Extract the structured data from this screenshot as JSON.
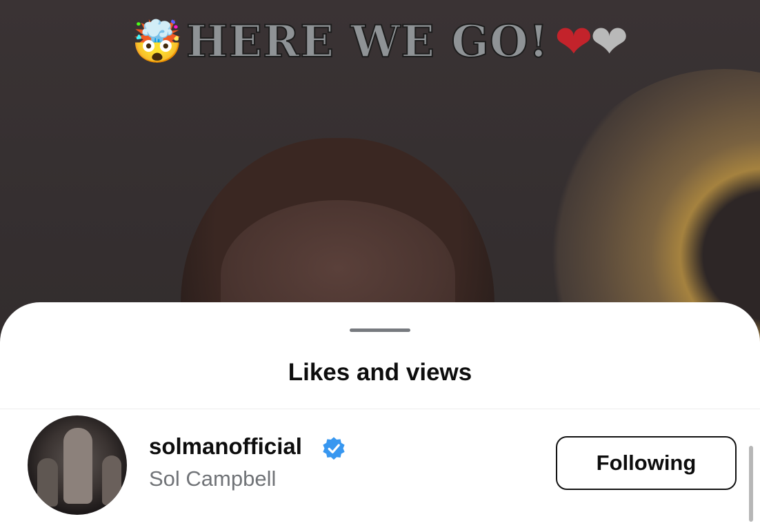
{
  "story": {
    "caption_emoji": "🤯",
    "caption_text": "HERE WE GO!",
    "hearts": [
      "❤",
      "❤"
    ]
  },
  "sheet": {
    "title": "Likes and views",
    "viewers": [
      {
        "username": "solmanofficial",
        "full_name": "Sol Campbell",
        "verified": true,
        "button_label": "Following"
      }
    ]
  },
  "colors": {
    "verified_badge": "#3897f0",
    "heart_red": "#c3232b",
    "heart_white": "#b9b9b9"
  }
}
